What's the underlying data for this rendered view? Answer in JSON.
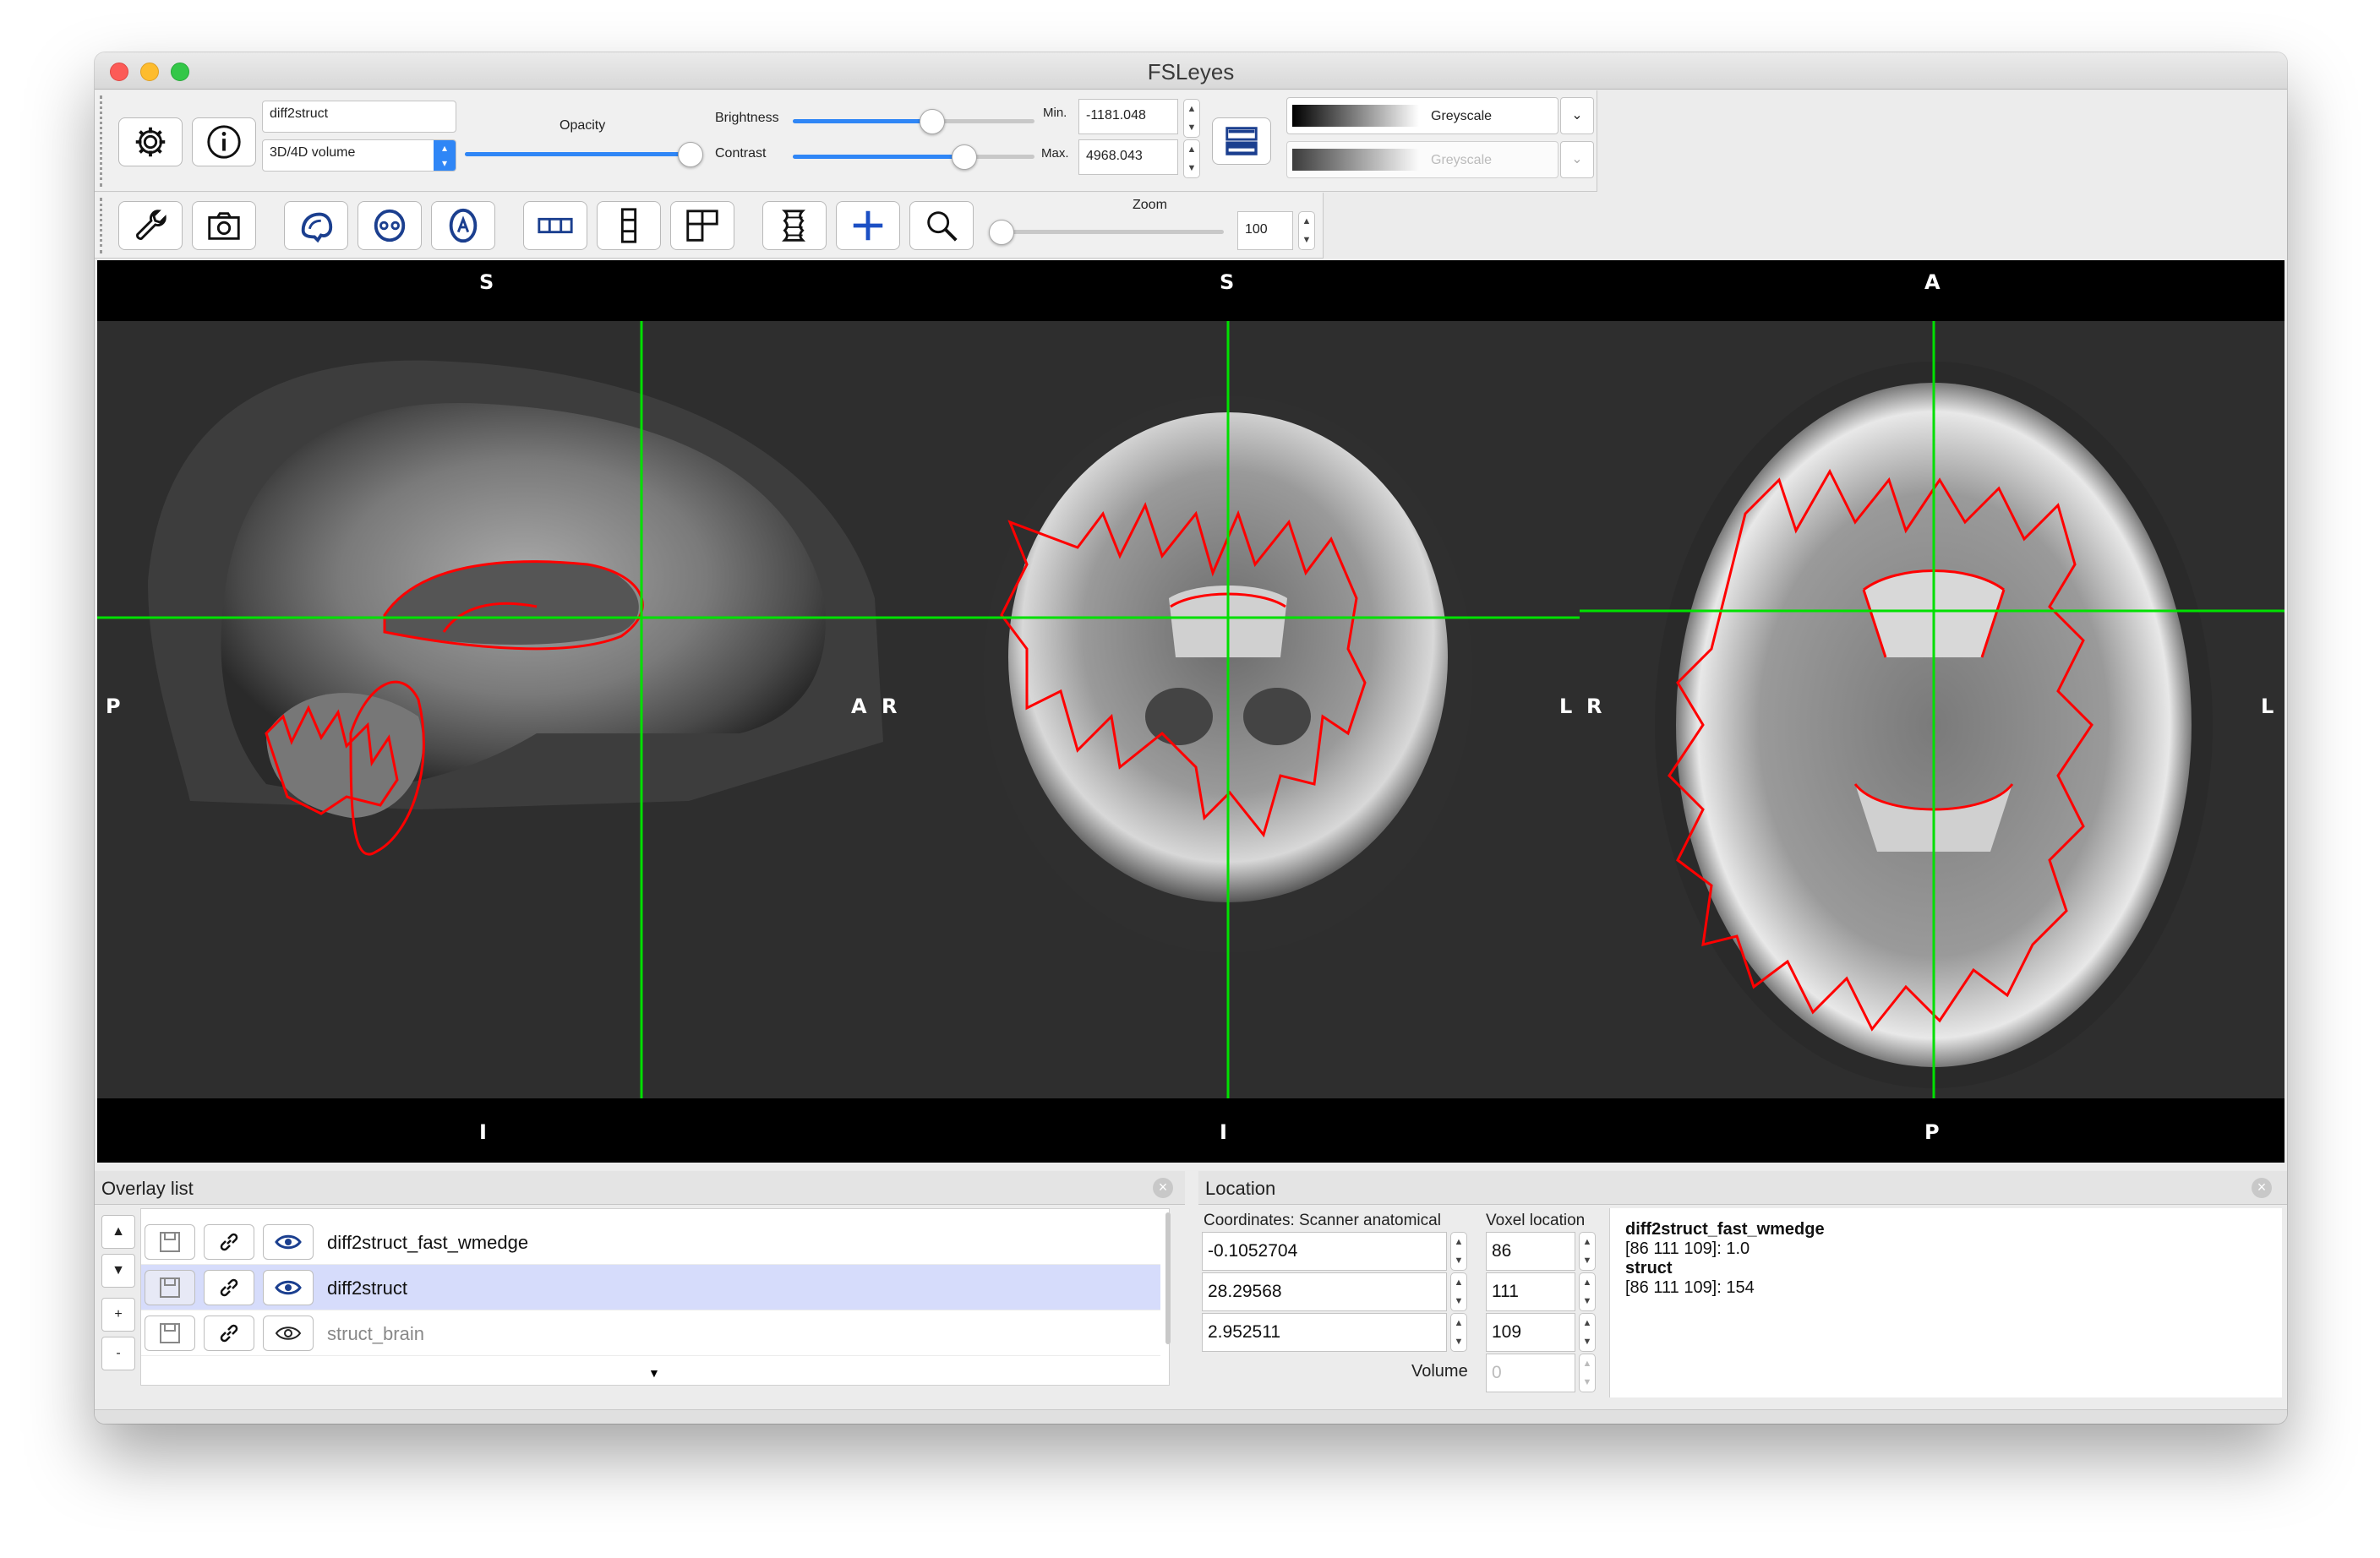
{
  "window": {
    "title": "FSLeyes"
  },
  "overlay_toolbar": {
    "overlay_name": "diff2struct",
    "overlay_type": "3D/4D volume",
    "opacity_label": "Opacity",
    "opacity_value": 0.92,
    "brightness_label": "Brightness",
    "brightness_value": 0.58,
    "contrast_label": "Contrast",
    "contrast_value": 0.72,
    "min_label": "Min.",
    "min_value": "-1181.048",
    "max_label": "Max.",
    "max_value": "4968.043",
    "colormap": "Greyscale",
    "neg_colormap": "Greyscale"
  },
  "ortho_toolbar": {
    "zoom_label": "Zoom",
    "zoom_value": "100",
    "icons": [
      "wrench-icon",
      "camera-icon",
      "sagittal-icon",
      "coronal-icon",
      "axial-icon",
      "horizontal-layout-icon",
      "vertical-layout-icon",
      "grid-layout-icon",
      "movie-icon",
      "crosshair-icon",
      "zoom-icon"
    ]
  },
  "views": {
    "sagittal": {
      "top": "S",
      "bottom": "I",
      "left": "P",
      "right": "A"
    },
    "coronal": {
      "top": "S",
      "bottom": "I",
      "left": "R",
      "right": "L"
    },
    "axial": {
      "top": "A",
      "bottom": "P",
      "left": "R",
      "right": "L"
    },
    "colors": {
      "crosshair": "#00e000",
      "edge": "#ff0000",
      "background": "#000000"
    }
  },
  "overlay_list": {
    "title": "Overlay list",
    "controls": [
      "▲",
      "▼",
      "+",
      "-"
    ],
    "items": [
      {
        "name": "diff2struct_fast_wmedge",
        "visible": true,
        "selected": false
      },
      {
        "name": "diff2struct",
        "visible": true,
        "selected": true
      },
      {
        "name": "struct_brain",
        "visible": false,
        "selected": false
      }
    ],
    "scroll_arrow": "▼"
  },
  "location": {
    "title": "Location",
    "coords_label": "Coordinates: Scanner anatomical",
    "voxel_label": "Voxel location",
    "coords": [
      "-0.1052704",
      "28.29568",
      "2.952511"
    ],
    "voxels": [
      "86",
      "111",
      "109"
    ],
    "volume_label": "Volume",
    "volume_value": "0",
    "info": [
      {
        "name": "diff2struct_fast_wmedge",
        "value": "[86 111 109]: 1.0"
      },
      {
        "name": "struct",
        "value": "[86 111 109]: 154"
      }
    ]
  }
}
